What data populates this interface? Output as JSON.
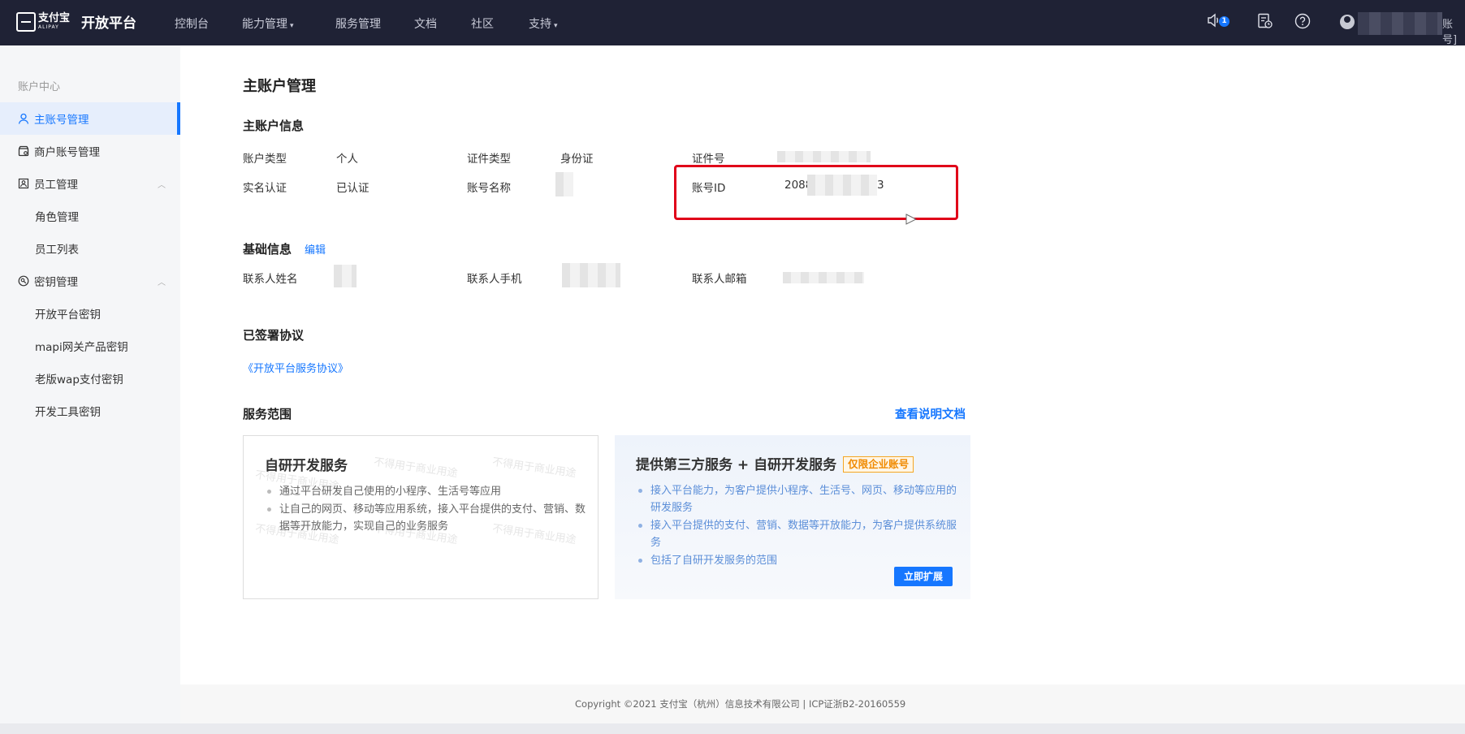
{
  "header": {
    "logo_cn": "支付宝",
    "logo_en": "ALIPAY",
    "title": "开放平台",
    "nav": [
      "控制台",
      "能力管理",
      "服务管理",
      "文档",
      "社区",
      "支持"
    ],
    "notification_count": "1",
    "user_suffix": "账号]"
  },
  "sidebar": {
    "section_title": "账户中心",
    "items": [
      {
        "label": "主账号管理",
        "icon": "user-icon"
      },
      {
        "label": "商户账号管理",
        "icon": "shop-icon"
      },
      {
        "label": "员工管理",
        "icon": "staff-icon"
      },
      {
        "label": "角色管理"
      },
      {
        "label": "员工列表"
      },
      {
        "label": "密钥管理",
        "icon": "key-icon"
      },
      {
        "label": "开放平台密钥"
      },
      {
        "label": "mapi网关产品密钥"
      },
      {
        "label": "老版wap支付密钥"
      },
      {
        "label": "开发工具密钥"
      }
    ]
  },
  "main": {
    "title": "主账户管理",
    "account_info": {
      "heading": "主账户信息",
      "account_type_label": "账户类型",
      "account_type_value": "个人",
      "cert_type_label": "证件类型",
      "cert_type_value": "身份证",
      "cert_no_label": "证件号",
      "realname_label": "实名认证",
      "realname_value": "已认证",
      "account_name_label": "账号名称",
      "account_id_label": "账号ID",
      "account_id_prefix": "2088",
      "account_id_suffix": "3"
    },
    "basic_info": {
      "heading": "基础信息",
      "edit": "编辑",
      "contact_name_label": "联系人姓名",
      "contact_phone_label": "联系人手机",
      "contact_email_label": "联系人邮箱"
    },
    "agreements": {
      "heading": "已签署协议",
      "link": "《开放平台服务协议》"
    },
    "service_scope": {
      "heading": "服务范围",
      "doc_link": "查看说明文档",
      "card1": {
        "title": "自研开发服务",
        "points": [
          "通过平台研发自己使用的小程序、生活号等应用",
          "让自己的网页、移动等应用系统，接入平台提供的支付、营销、数据等开放能力，实现自己的业务服务"
        ]
      },
      "card2": {
        "title": "提供第三方服务 + 自研开发服务",
        "tag": "仅限企业账号",
        "points": [
          "接入平台能力，为客户提供小程序、生活号、网页、移动等应用的研发服务",
          "接入平台提供的支付、营销、数据等开放能力，为客户提供系统服务",
          "包括了自研开发服务的范围"
        ],
        "button": "立即扩展"
      },
      "watermark": "不得用于商业用途"
    }
  },
  "footer": {
    "copyright": "Copyright ©2021 支付宝（杭州）信息技术有限公司 | ICP证浙B2-20160559"
  },
  "colors": {
    "accent": "#1677ff",
    "nav_bg": "#1f2235",
    "highlight": "#e00019"
  }
}
